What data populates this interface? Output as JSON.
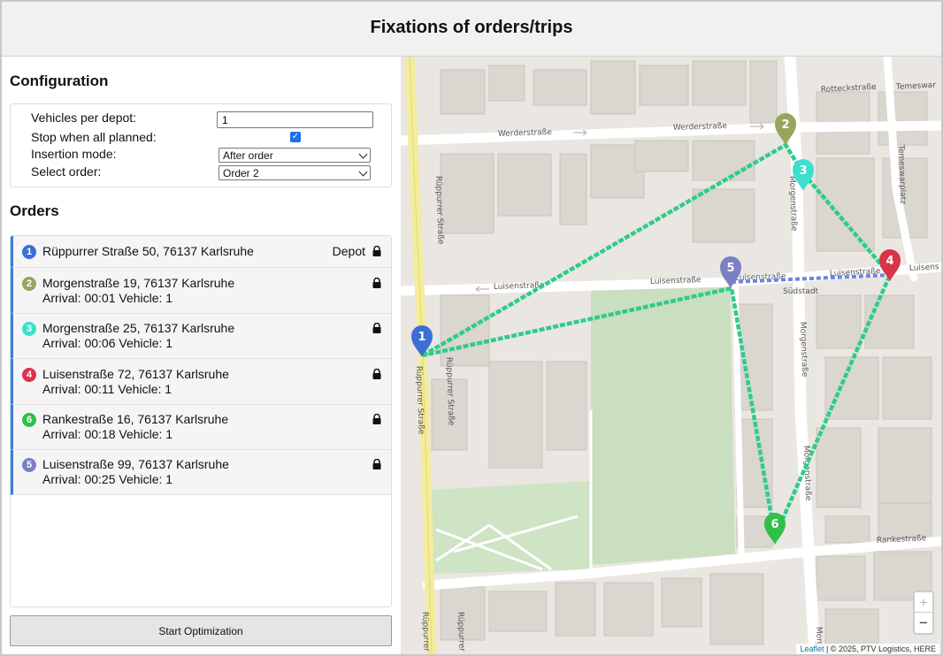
{
  "header": {
    "title": "Fixations of orders/trips"
  },
  "configuration": {
    "title": "Configuration",
    "vehicles_label": "Vehicles per depot:",
    "vehicles_value": "1",
    "stop_label": "Stop when all planned:",
    "stop_checked": true,
    "insertion_label": "Insertion mode:",
    "insertion_value": "After order",
    "select_order_label": "Select order:",
    "select_order_value": "Order 2"
  },
  "orders": {
    "title": "Orders",
    "items": [
      {
        "badge": "1",
        "color": "#3b6fd6",
        "address": "Rüppurrer Straße 50, 76137 Karlsruhe",
        "depot": "Depot",
        "meta": ""
      },
      {
        "badge": "2",
        "color": "#98a55e",
        "address": "Morgenstraße 19, 76137 Karlsruhe",
        "meta": "Arrival: 00:01 Vehicle: 1"
      },
      {
        "badge": "3",
        "color": "#3ee0cc",
        "address": "Morgenstraße 25, 76137 Karlsruhe",
        "meta": "Arrival: 00:06 Vehicle: 1"
      },
      {
        "badge": "4",
        "color": "#d9344a",
        "address": "Luisenstraße 72, 76137 Karlsruhe",
        "meta": "Arrival: 00:11 Vehicle: 1"
      },
      {
        "badge": "6",
        "color": "#2fbf4a",
        "address": "Rankestraße 16, 76137 Karlsruhe",
        "meta": "Arrival: 00:18 Vehicle: 1"
      },
      {
        "badge": "5",
        "color": "#7a80c4",
        "address": "Luisenstraße 99, 76137 Karlsruhe",
        "meta": "Arrival: 00:25 Vehicle: 1"
      }
    ]
  },
  "start_button": "Start Optimization",
  "map": {
    "streets": {
      "rottecks": "Rotteckstraße",
      "temeswar_top": "Temeswar",
      "werder_left": "Werderstraße",
      "werder_right": "Werderstraße",
      "ruppurrer_top": "Rüppurrer Straße",
      "ruppurrer_mid": "Rüppurrer Straße",
      "ruppurrer_mid2": "Rüppurrer Straße",
      "ruppurrer_bottom": "Rüppurrer",
      "morgen_top": "Morgenstraße",
      "morgen_mid": "Morgenstraße",
      "morgen_low": "Morgenstraße",
      "morgen_bottom": "Morg",
      "temeswarplatz": "Temeswarplatz",
      "luisen_left": "Luisenstraße",
      "luisen_mid": "Luisenstraße",
      "luisen_mid2": "Luisenstraße",
      "luisen_right": "Luisenstraße",
      "luisen_far": "Luisens",
      "suedstadt": "Südstadt",
      "ranke": "Rankestraße"
    },
    "markers": [
      {
        "label": "1",
        "color": "#3b6fd6"
      },
      {
        "label": "2",
        "color": "#98a55e"
      },
      {
        "label": "3",
        "color": "#3ee0cc"
      },
      {
        "label": "4",
        "color": "#d9344a"
      },
      {
        "label": "5",
        "color": "#7a80c4"
      },
      {
        "label": "6",
        "color": "#2fbf4a"
      }
    ],
    "route_color": "#2ecc8a",
    "zoom_in": "+",
    "zoom_out": "−",
    "attribution_link": "Leaflet",
    "attribution_text": " | © 2025, PTV Logistics, HERE"
  }
}
